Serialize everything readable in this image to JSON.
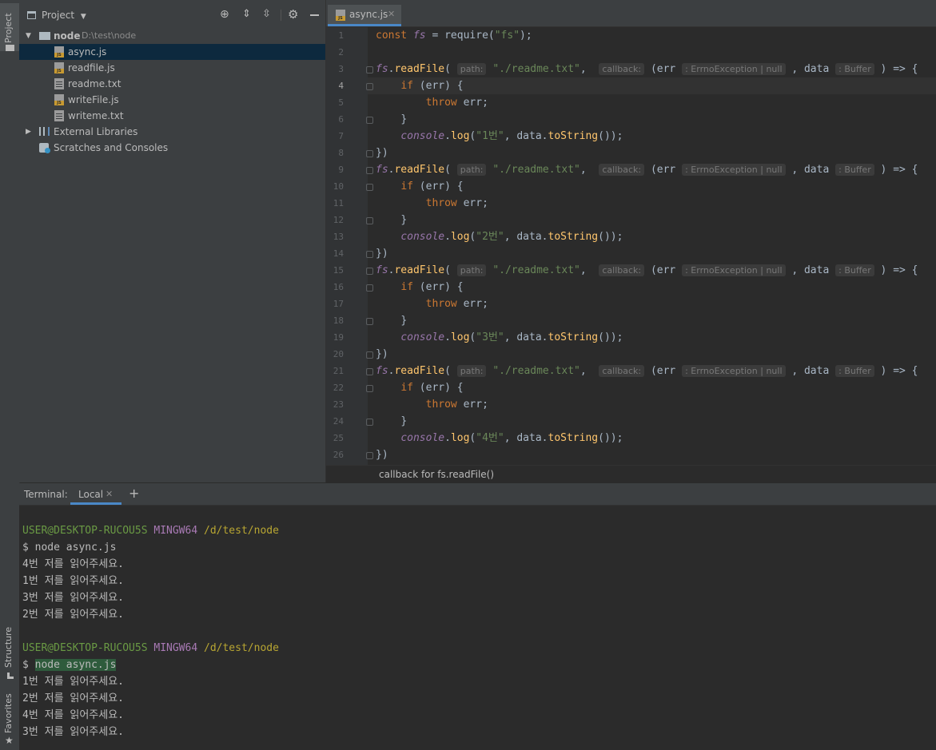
{
  "left_strip": {
    "project_label": "Project",
    "structure_label": "Structure",
    "favorites_label": "Favorites"
  },
  "project_panel": {
    "title": "Project",
    "tree": [
      {
        "name": "node",
        "path_hint": "D:\\test\\node"
      },
      {
        "name": "async.js"
      },
      {
        "name": "readfile.js"
      },
      {
        "name": "readme.txt"
      },
      {
        "name": "writeFile.js"
      },
      {
        "name": "writeme.txt"
      },
      {
        "name": "External Libraries"
      },
      {
        "name": "Scratches and Consoles"
      }
    ]
  },
  "editor": {
    "tab_label": "async.js",
    "status_hint": "callback for fs.readFile()",
    "line_numbers": [
      "1",
      "2",
      "3",
      "4",
      "5",
      "6",
      "7",
      "8",
      "9",
      "10",
      "11",
      "12",
      "13",
      "14",
      "15",
      "16",
      "17",
      "18",
      "19",
      "20",
      "21",
      "22",
      "23",
      "24",
      "25",
      "26"
    ],
    "code": {
      "const_kw": "const",
      "fs_var": "fs",
      "assign": " = ",
      "require_fn": "require",
      "require_arg": "\"fs\"",
      "readfile_fn": "readFile",
      "path_hint": "path:",
      "path_str": "\"./readme.txt\"",
      "callback_hint": "callback:",
      "err_name": "err",
      "err_type_hint": ": ErrnoException | null",
      "data_name": "data",
      "data_type_hint": ": Buffer",
      "arrow": ") => {",
      "if_kw": "if",
      "if_cond": " (err) {",
      "throw_kw": "throw",
      "throw_rest": " err;",
      "close_brace": "}",
      "close_paren": "})",
      "console_var": "console",
      "log_fn": "log",
      "tostring_fn": "toString",
      "log_args": [
        "\"1번\"",
        "\"2번\"",
        "\"3번\"",
        "\"4번\""
      ]
    }
  },
  "terminal": {
    "label": "Terminal:",
    "tab_local": "Local",
    "add_label": "+",
    "user": "USER@DESKTOP-RUCOU5S",
    "host": "MINGW64",
    "path": "/d/test/node",
    "prompt": "$",
    "command": "node async.js",
    "run1": [
      "4번 저를 읽어주세요.",
      "1번 저를 읽어주세요.",
      "3번 저를 읽어주세요.",
      "2번 저를 읽어주세요."
    ],
    "run2": [
      "1번 저를 읽어주세요.",
      "2번 저를 읽어주세요.",
      "4번 저를 읽어주세요.",
      "3번 저를 읽어주세요."
    ]
  }
}
